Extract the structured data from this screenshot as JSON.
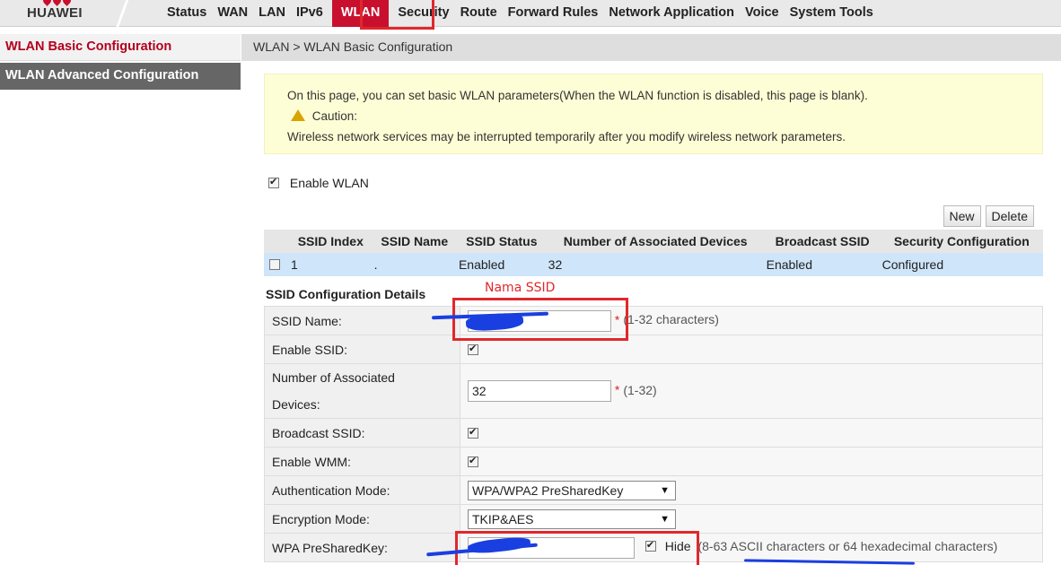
{
  "brand": {
    "name": "HUAWEI"
  },
  "nav": [
    "Status",
    "WAN",
    "LAN",
    "IPv6",
    "WLAN",
    "Security",
    "Route",
    "Forward Rules",
    "Network Application",
    "Voice",
    "System Tools"
  ],
  "nav_active": "WLAN",
  "sidebar": [
    {
      "label": "WLAN Basic Configuration",
      "active": true
    },
    {
      "label": "WLAN Advanced Configuration",
      "active": false
    }
  ],
  "breadcrumb": "WLAN > WLAN Basic Configuration",
  "notice": {
    "line1": "On this page, you can set basic WLAN parameters(When the WLAN function is disabled, this page is blank).",
    "caution": "Caution:",
    "line2": "Wireless network services may be interrupted temporarily after you modify wireless network parameters."
  },
  "enable_wlan": {
    "label": "Enable WLAN",
    "checked": true
  },
  "buttons": {
    "new": "New",
    "delete": "Delete"
  },
  "ssid_table": {
    "headers": [
      "SSID Index",
      "SSID Name",
      "SSID Status",
      "Number of Associated Devices",
      "Broadcast SSID",
      "Security Configuration"
    ],
    "rows": [
      [
        "1",
        ".",
        "Enabled",
        "32",
        "Enabled",
        "Configured"
      ]
    ]
  },
  "details": {
    "title": "SSID Configuration Details",
    "annotation": "Nama SSID",
    "ssid_name_label": "SSID Name:",
    "ssid_name_hint": "(1-32 characters)",
    "enable_ssid_label": "Enable SSID:",
    "assoc_label_1": "Number of Associated",
    "assoc_label_2": "Devices:",
    "assoc_value": "32",
    "assoc_hint": "(1-32)",
    "broadcast_label": "Broadcast SSID:",
    "wmm_label": "Enable WMM:",
    "auth_label": "Authentication Mode:",
    "auth_value": "WPA/WPA2 PreSharedKey",
    "enc_label": "Encryption Mode:",
    "enc_value": "TKIP&AES",
    "psk_label": "WPA PreSharedKey:",
    "psk_hide": "Hide",
    "psk_hint": "(8-63 ASCII characters or 64 hexadecimal characters)"
  },
  "colors": {
    "accent": "#c8102e",
    "annotation": "#e0282c",
    "scribble": "#1a3fe0"
  }
}
